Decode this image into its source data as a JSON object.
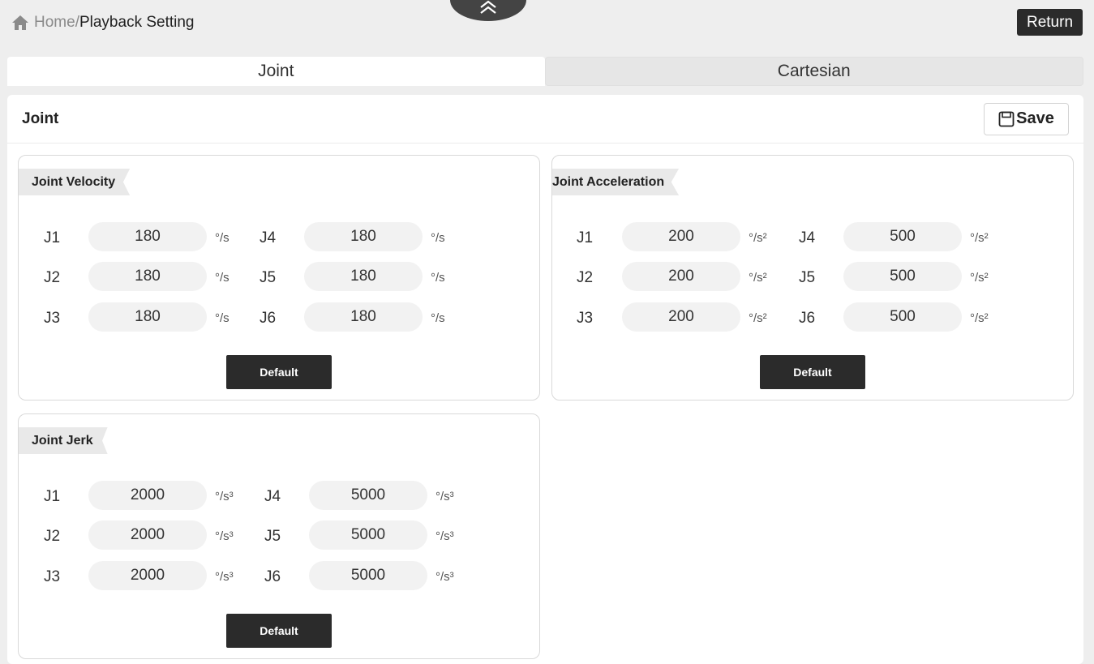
{
  "breadcrumb": {
    "home": "Home",
    "separator": "/",
    "current": "Playback Setting"
  },
  "header": {
    "return_label": "Return"
  },
  "tabs": [
    {
      "label": "Joint"
    },
    {
      "label": "Cartesian"
    }
  ],
  "panel": {
    "title": "Joint",
    "save_label": "Save"
  },
  "velocity": {
    "title": "Joint Velocity",
    "unit": "°/s",
    "rows": [
      {
        "left_joint": "J1",
        "left_value": "180",
        "right_joint": "J4",
        "right_value": "180"
      },
      {
        "left_joint": "J2",
        "left_value": "180",
        "right_joint": "J5",
        "right_value": "180"
      },
      {
        "left_joint": "J3",
        "left_value": "180",
        "right_joint": "J6",
        "right_value": "180"
      }
    ],
    "default_label": "Default"
  },
  "acceleration": {
    "title": "Joint Acceleration",
    "unit": "°/s²",
    "rows": [
      {
        "left_joint": "J1",
        "left_value": "200",
        "right_joint": "J4",
        "right_value": "500"
      },
      {
        "left_joint": "J2",
        "left_value": "200",
        "right_joint": "J5",
        "right_value": "500"
      },
      {
        "left_joint": "J3",
        "left_value": "200",
        "right_joint": "J6",
        "right_value": "500"
      }
    ],
    "default_label": "Default"
  },
  "jerk": {
    "title": "Joint Jerk",
    "unit": "°/s³",
    "rows": [
      {
        "left_joint": "J1",
        "left_value": "2000",
        "right_joint": "J4",
        "right_value": "5000"
      },
      {
        "left_joint": "J2",
        "left_value": "2000",
        "right_joint": "J5",
        "right_value": "5000"
      },
      {
        "left_joint": "J3",
        "left_value": "2000",
        "right_joint": "J6",
        "right_value": "5000"
      }
    ],
    "default_label": "Default"
  },
  "icons": {
    "home": "home-icon",
    "collapse": "double-chevron-up-icon",
    "save": "floppy-disk-icon"
  }
}
